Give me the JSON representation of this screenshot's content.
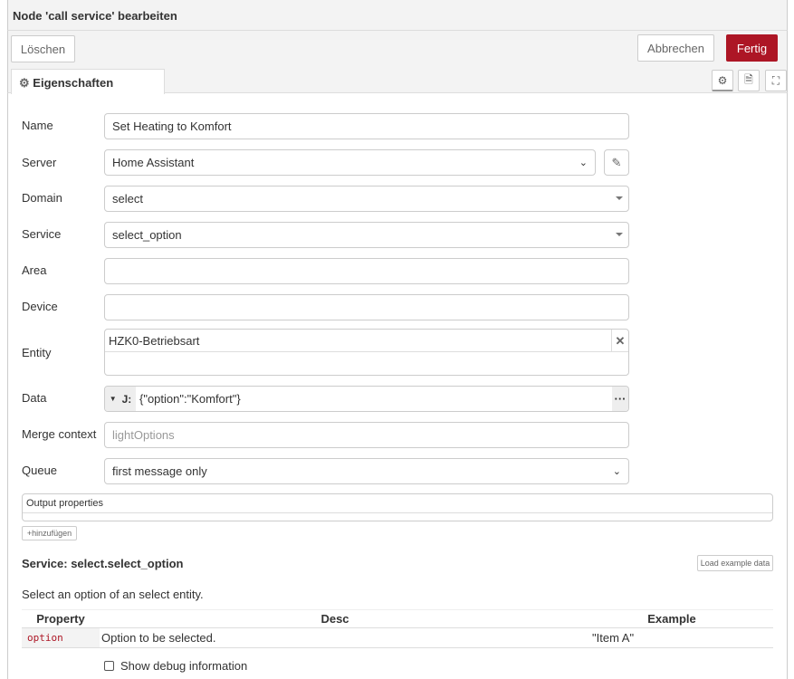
{
  "dialog": {
    "title": "Node 'call service' bearbeiten"
  },
  "toolbar": {
    "delete": "Löschen",
    "cancel": "Abbrechen",
    "done": "Fertig"
  },
  "tabs": {
    "properties": "Eigenschaften"
  },
  "icons": {
    "settings": "gear-icon",
    "description": "document-icon",
    "appearance": "frame-icon"
  },
  "form": {
    "name": {
      "label": "Name",
      "value": "Set Heating to Komfort"
    },
    "server": {
      "label": "Server",
      "value": "Home Assistant"
    },
    "domain": {
      "label": "Domain",
      "value": "select"
    },
    "service": {
      "label": "Service",
      "value": "select_option"
    },
    "area": {
      "label": "Area",
      "value": ""
    },
    "device": {
      "label": "Device",
      "value": ""
    },
    "entity": {
      "label": "Entity",
      "value": "HZK0-Betriebsart"
    },
    "data": {
      "label": "Data",
      "type": "J:",
      "value": "{\"option\":\"Komfort\"}"
    },
    "merge": {
      "label": "Merge context",
      "placeholder": "lightOptions"
    },
    "queue": {
      "label": "Queue",
      "value": "first message only"
    }
  },
  "output": {
    "title": "Output properties",
    "add": "hinzufügen"
  },
  "service_info": {
    "title": "Service: select.select_option",
    "load": "Load example data",
    "description": "Select an option of an select entity.",
    "headers": [
      "Property",
      "Desc",
      "Example"
    ],
    "rows": [
      {
        "property": "option",
        "desc": "Option to be selected.",
        "example": "\"Item A\""
      }
    ]
  },
  "debug": {
    "label": "Show debug information",
    "checked": false
  },
  "colors": {
    "accent": "#ad1625"
  }
}
